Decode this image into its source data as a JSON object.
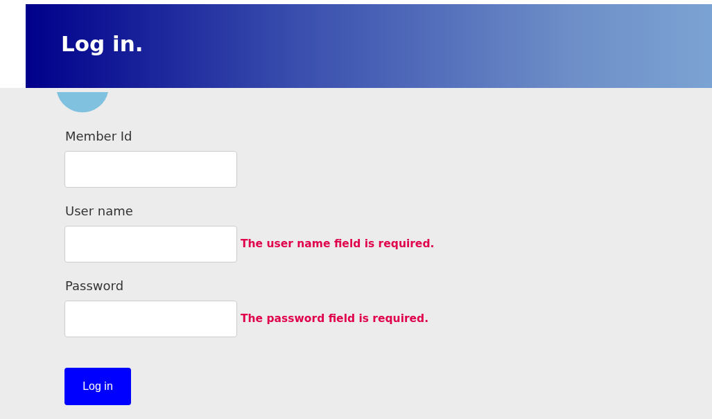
{
  "header": {
    "title": "Log in."
  },
  "fields": [
    {
      "label": "Member Id"
    },
    {
      "label": "User name",
      "error": "The user name field is required."
    },
    {
      "label": "Password",
      "error": "The password field is required."
    }
  ],
  "submit_button": {
    "label": "Log in"
  }
}
